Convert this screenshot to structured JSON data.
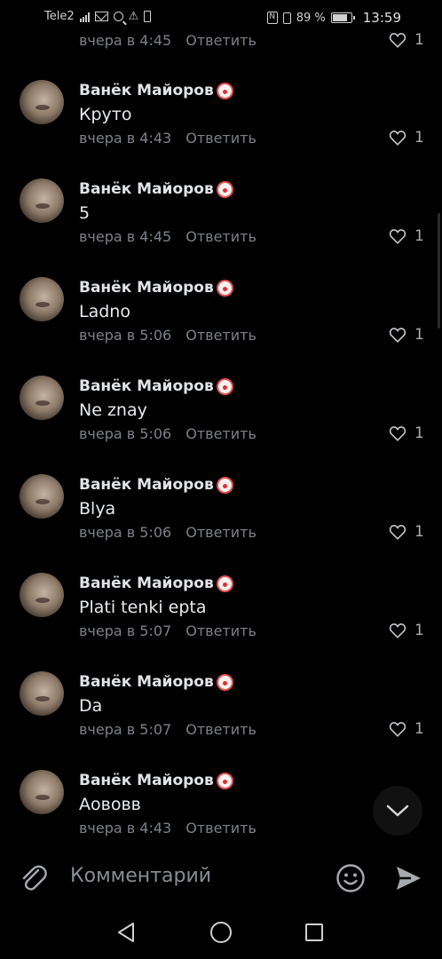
{
  "status_bar": {
    "carrier": "Tele2",
    "battery_percent": "89 %",
    "time": "13:59"
  },
  "top_partial": {
    "timestamp": "вчера в 4:45",
    "reply_label": "Ответить",
    "likes": "1"
  },
  "comments": [
    {
      "author": "Ванёк Майоров",
      "text": "Круто",
      "timestamp": "вчера в 4:43",
      "reply_label": "Ответить",
      "likes": "1"
    },
    {
      "author": "Ванёк Майоров",
      "text": "5",
      "timestamp": "вчера в 4:45",
      "reply_label": "Ответить",
      "likes": "1"
    },
    {
      "author": "Ванёк Майоров",
      "text": "Ladno",
      "timestamp": "вчера в 5:06",
      "reply_label": "Ответить",
      "likes": "1"
    },
    {
      "author": "Ванёк Майоров",
      "text": "Ne znay",
      "timestamp": "вчера в 5:06",
      "reply_label": "Ответить",
      "likes": "1"
    },
    {
      "author": "Ванёк Майоров",
      "text": "Blya",
      "timestamp": "вчера в 5:06",
      "reply_label": "Ответить",
      "likes": "1"
    },
    {
      "author": "Ванёк Майоров",
      "text": "Plati tenki epta",
      "timestamp": "вчера в 5:07",
      "reply_label": "Ответить",
      "likes": "1"
    },
    {
      "author": "Ванёк Майоров",
      "text": "Da",
      "timestamp": "вчера в 5:07",
      "reply_label": "Ответить",
      "likes": "1"
    },
    {
      "author": "Ванёк Майоров",
      "text": "Аововв",
      "timestamp": "вчера в 4:43",
      "reply_label": "Ответить",
      "likes": ""
    }
  ],
  "input": {
    "placeholder": "Комментарий"
  },
  "icons": {
    "author_badge": "clown-face-icon",
    "like": "heart-outline-icon",
    "attach": "paperclip-icon",
    "emoji": "smiley-icon",
    "send": "send-icon",
    "scroll_down": "chevron-down-icon"
  },
  "colors": {
    "background": "#000000",
    "text_primary": "#e1e3e6",
    "text_secondary": "#7d8187"
  }
}
